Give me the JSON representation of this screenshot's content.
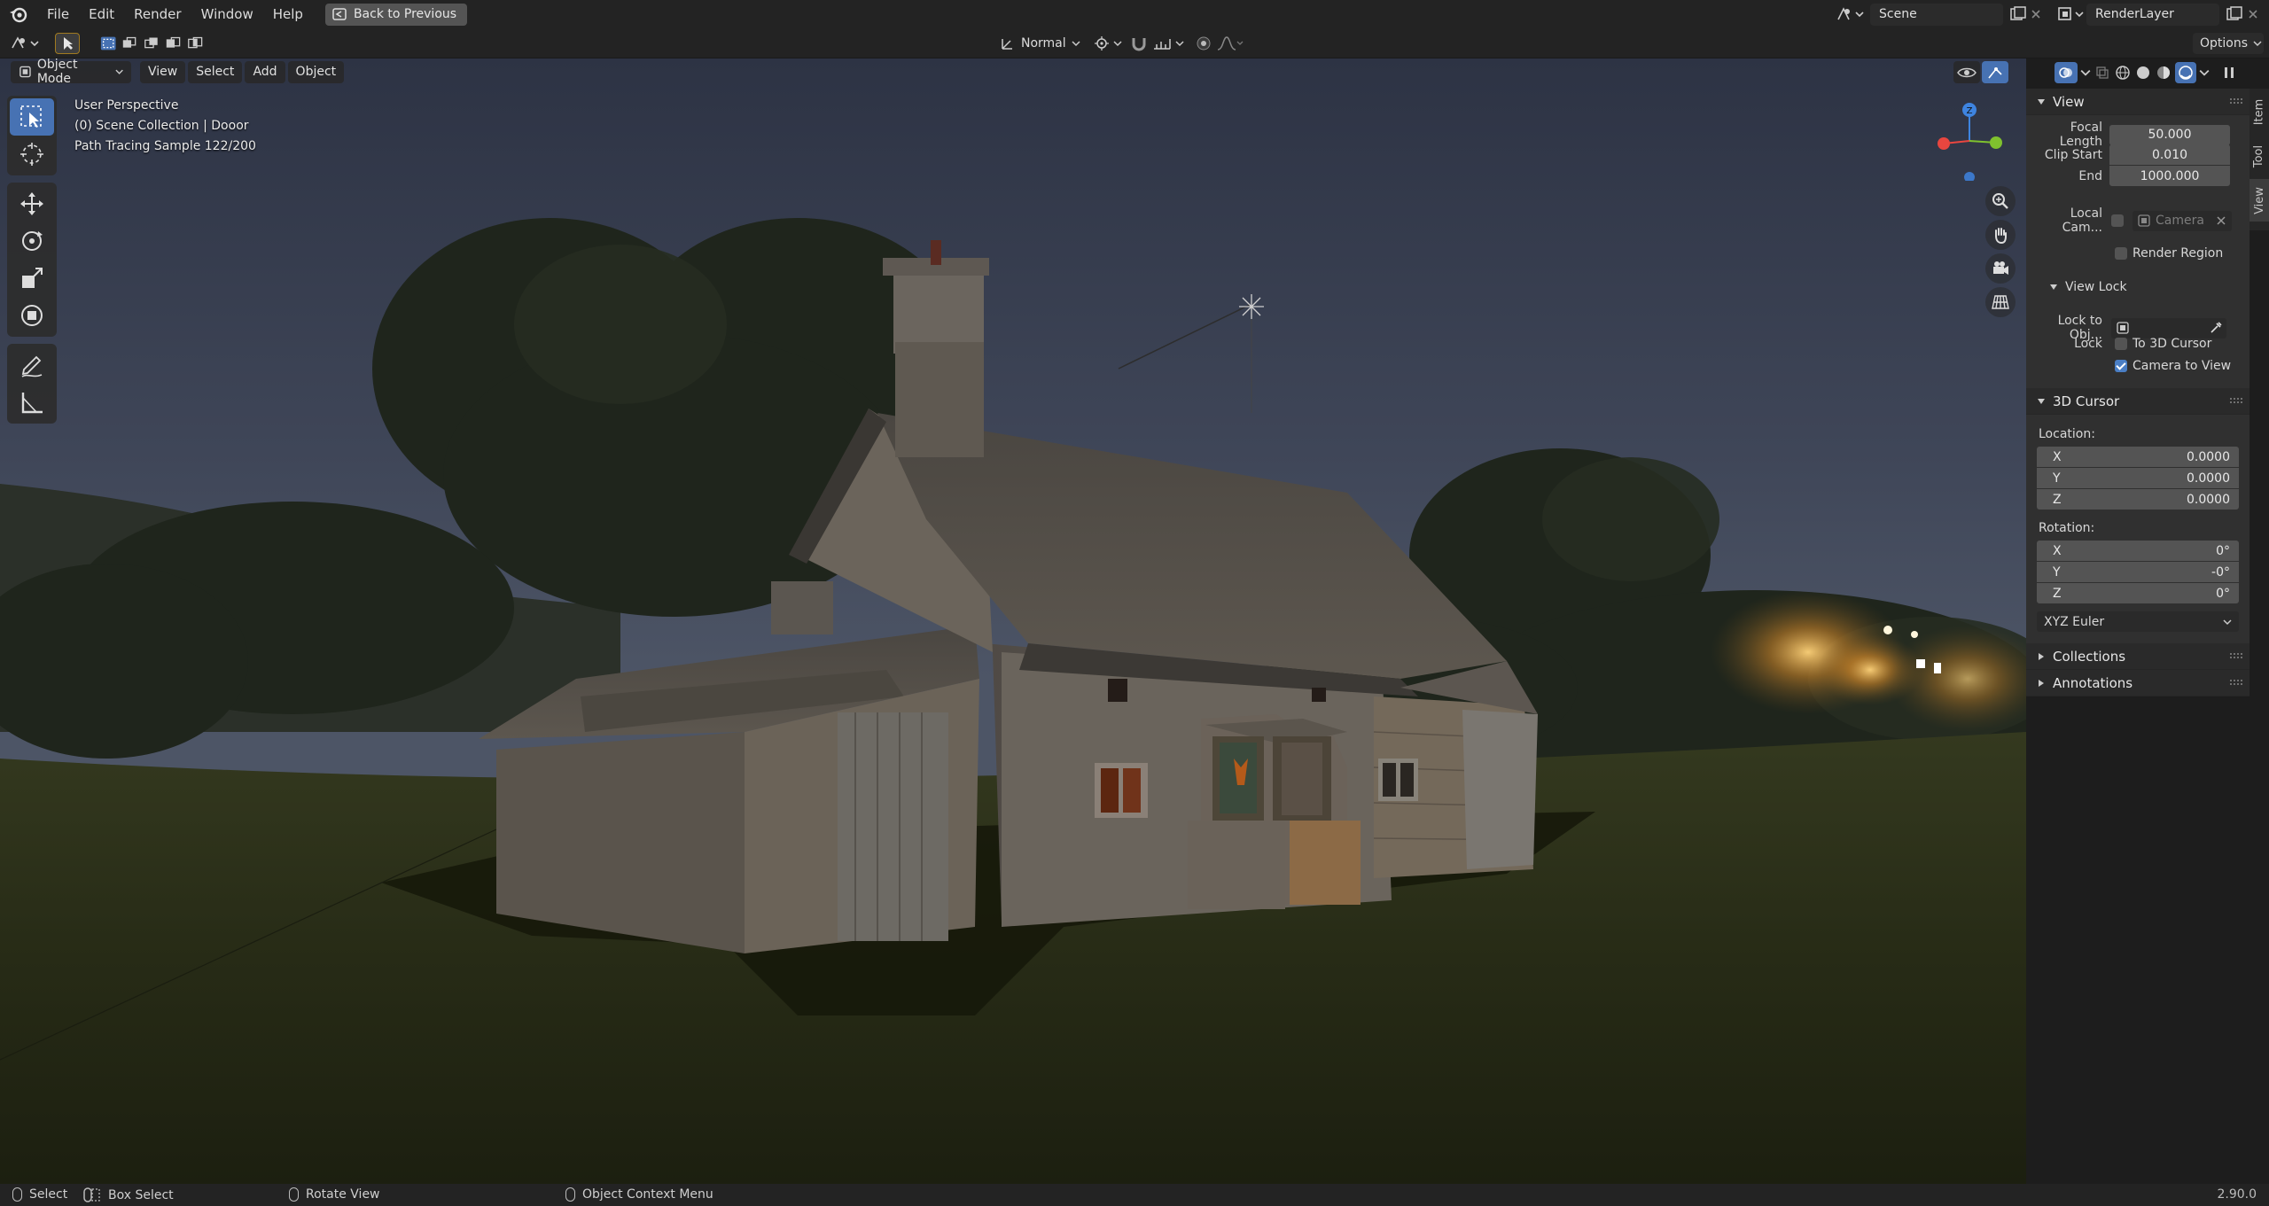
{
  "menu": {
    "items": [
      "File",
      "Edit",
      "Render",
      "Window",
      "Help"
    ],
    "back_label": "Back to Previous"
  },
  "scene": {
    "scene_name": "Scene",
    "render_layer": "RenderLayer"
  },
  "header": {
    "orientation": "Normal",
    "options_label": "Options"
  },
  "viewport_header": {
    "mode": "Object Mode",
    "menus": [
      "View",
      "Select",
      "Add",
      "Object"
    ]
  },
  "viewport_info": {
    "line1": "User Perspective",
    "line2": "(0) Scene Collection | Dooor",
    "line3": "Path Tracing Sample 122/200"
  },
  "gizmo": {
    "z_label": "Z"
  },
  "sidebar": {
    "tabs": [
      "Item",
      "Tool",
      "View"
    ],
    "active_tab": "View",
    "view_panel": {
      "title": "View",
      "focal_length_label": "Focal Length",
      "focal_length": "50.000",
      "clip_start_label": "Clip Start",
      "clip_start": "0.010",
      "end_label": "End",
      "end": "1000.000",
      "local_camera_label": "Local Cam...",
      "camera_placeholder": "Camera",
      "render_region_label": "Render Region",
      "view_lock_title": "View Lock",
      "lock_to_object_label": "Lock to Obj...",
      "lock_label": "Lock",
      "to_3d_cursor_label": "To 3D Cursor",
      "camera_to_view_label": "Camera to View",
      "camera_to_view_checked": true
    },
    "cursor_panel": {
      "title": "3D Cursor",
      "location_label": "Location:",
      "location": {
        "x": "0.0000",
        "y": "0.0000",
        "z": "0.0000"
      },
      "rotation_label": "Rotation:",
      "rotation": {
        "x": "0°",
        "y": "-0°",
        "z": "0°"
      },
      "rotation_mode": "XYZ Euler",
      "axis_x": "X",
      "axis_y": "Y",
      "axis_z": "Z"
    },
    "collections_title": "Collections",
    "annotations_title": "Annotations"
  },
  "statusbar": {
    "select": "Select",
    "box_select": "Box Select",
    "rotate_view": "Rotate View",
    "context_menu": "Object Context Menu",
    "version": "2.90.0"
  },
  "colors": {
    "accent": "#4772b3",
    "gizmo_x": "#e8463f",
    "gizmo_y": "#7fc12e",
    "gizmo_z": "#3e84e0"
  }
}
